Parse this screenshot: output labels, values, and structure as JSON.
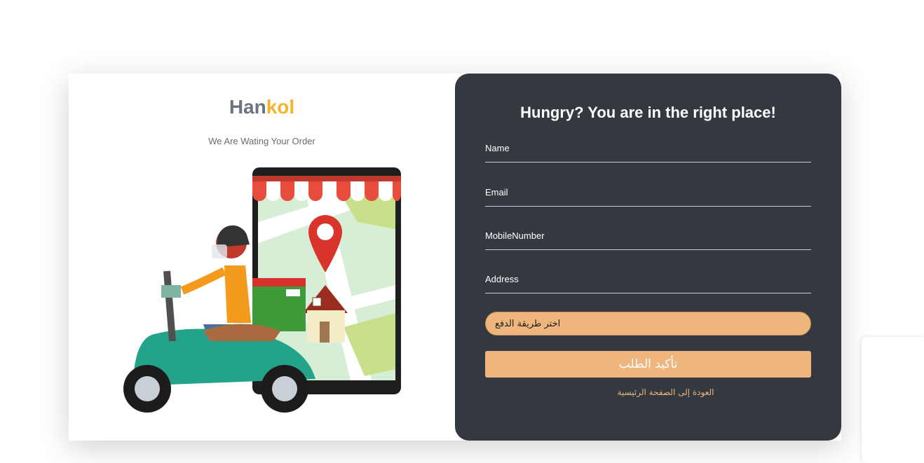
{
  "brand": {
    "part1": "Han",
    "part2": "kol"
  },
  "tagline": "We Are Wating Your Order",
  "form": {
    "heading": "Hungry? You are in the right place!",
    "fields": [
      {
        "label": "Name"
      },
      {
        "label": "Email"
      },
      {
        "label": "MobileNumber"
      },
      {
        "label": "Address"
      }
    ],
    "payment_select": "اختر طريقة الدفع",
    "submit_label": "تأكيد الطلب",
    "back_link": "العودة إلى الصفحة الرئيسية"
  },
  "colors": {
    "panel": "#343940",
    "accent": "#eeb57c",
    "brand_gray": "#6b7280",
    "brand_yellow": "#f4b32a"
  }
}
